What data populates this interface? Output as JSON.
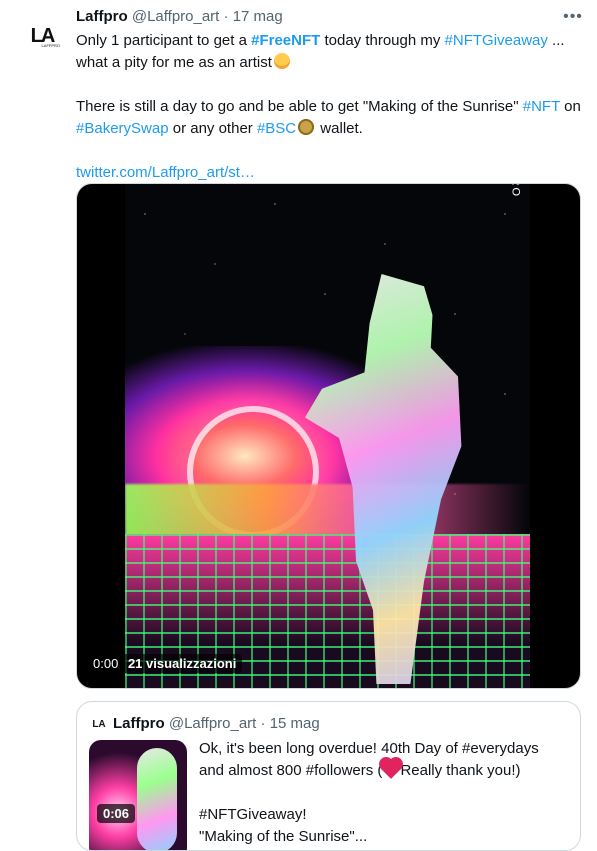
{
  "tweet": {
    "author": {
      "name": "Laffpro",
      "handle": "@Laffpro_art",
      "date": "17 mag",
      "avatar_monogram": "LA",
      "avatar_small": "LAFFPRO"
    },
    "text": {
      "p1_a": "Only 1 participant to get a ",
      "p1_tag1": "#FreeNFT",
      "p1_b": " today through my ",
      "p1_tag2": "#NFTGiveaway",
      "p1_c": " ... what a pity for me as an artist",
      "p2_a": "There is still a day to go and be able to get \"Making of the Sunrise\" ",
      "p2_tag1": "#NFT",
      "p2_b": " on ",
      "p2_tag2": "#BakerySwap",
      "p2_c": " or any other ",
      "p2_tag3": "#BSC",
      "p2_d": " wallet.",
      "link": "twitter.com/Laffpro_art/st…"
    },
    "media": {
      "time": "0:00",
      "views": "21 visualizzazioni",
      "brand_vertical": "LAFFPRO"
    },
    "more_icon": "more-icon"
  },
  "quoted": {
    "author": {
      "name": "Laffpro",
      "handle": "@Laffpro_art",
      "date": "15 mag",
      "avatar_monogram": "LA"
    },
    "thumb_time": "0:06",
    "text": {
      "line1": "Ok, it's been long overdue! 40th Day of #everydays",
      "line2_a": "and almost 800 #followers (",
      "line2_b": "Really thank you!)",
      "line3": "#NFTGiveaway!",
      "line4": "\"Making of the Sunrise\"..."
    }
  }
}
